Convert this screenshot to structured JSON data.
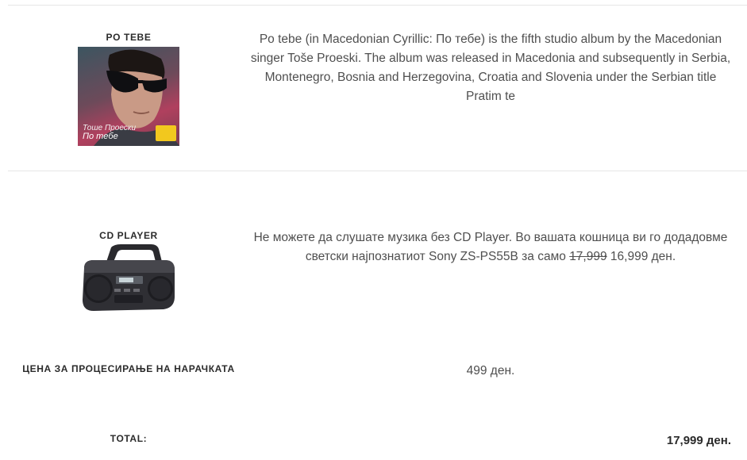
{
  "album": {
    "label": "PO TEBE",
    "cover_line1": "Тоше Проески",
    "cover_line2": "По тебе",
    "description": "Po tebe (in Macedonian Cyrillic: По тебе) is the fifth studio album by the Macedonian singer Toše Proeski. The album was released in Macedonia and subsequently in Serbia, Montenegro, Bosnia and Herzegovina, Croatia and Slovenia under the Serbian title Pratim te"
  },
  "cd_player": {
    "label": "CD PLAYER",
    "description_prefix": "Не можете да слушате музика без CD Player. Во вашата кошница ви го додадовме светски најпознатиот Sony ZS-PS55B за само",
    "old_price": "17,999",
    "new_price": "16,999 ден."
  },
  "processing": {
    "label": "ЦЕНА ЗА ПРОЦЕСИРАЊЕ НА НАРАЧКАТА",
    "value": "499 ден."
  },
  "total": {
    "label": "TOTAL:",
    "value": "17,999 ден."
  }
}
